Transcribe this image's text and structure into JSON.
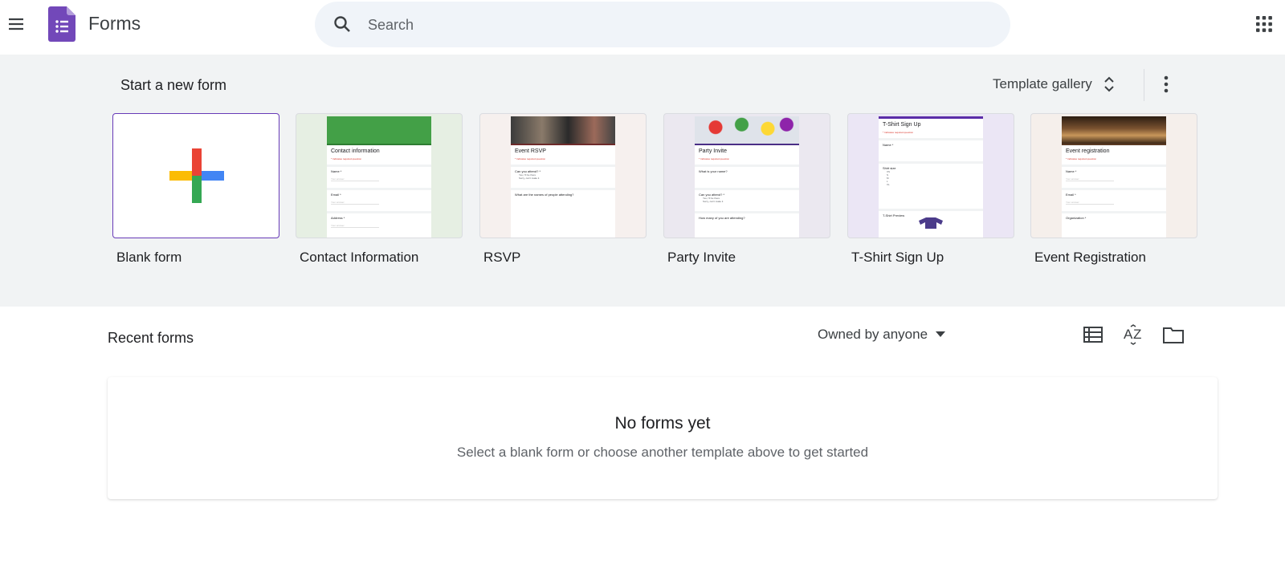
{
  "header": {
    "app_title": "Forms",
    "search": {
      "placeholder": "Search",
      "value": ""
    },
    "icons": {
      "menu": "hamburger-menu-icon",
      "logo": "google-forms-logo",
      "search": "search-icon",
      "apps": "google-apps-grid-icon"
    }
  },
  "templates": {
    "section_title": "Start a new form",
    "gallery_label": "Template gallery",
    "items": [
      {
        "label": "Blank form",
        "accent": "#673ab7",
        "bg": "#ffffff"
      },
      {
        "label": "Contact Information",
        "accent": "#43a047",
        "bg": "#e6efe3",
        "doc_title": "Contact information",
        "doc_req": "* Indicates required question",
        "q": [
          "Name *",
          "Email *",
          "Address *"
        ],
        "placeholder": "Your answer"
      },
      {
        "label": "RSVP",
        "accent": "#6d2a2a",
        "bg": "#f6f0ee",
        "doc_title": "Event RSVP",
        "doc_req": "* Indicates required question",
        "q": [
          "Can you attend? *",
          "What are the names of people attending?"
        ],
        "opts": [
          "Yes, I'll be there",
          "Sorry, can't make it"
        ]
      },
      {
        "label": "Party Invite",
        "accent": "#4a2e86",
        "bg": "#ebe8f0",
        "doc_title": "Party Invite",
        "doc_req": "* Indicates required question",
        "q": [
          "What is your name?",
          "Can you attend? *",
          "How many of you are attending?"
        ],
        "opts": [
          "Yes, I'll be there",
          "Sorry, can't make it"
        ]
      },
      {
        "label": "T-Shirt Sign Up",
        "accent": "#5b2da8",
        "bg": "#ebe6f5",
        "doc_title": "T-Shirt Sign Up",
        "doc_req": "* Indicates required question",
        "q": [
          "Name *",
          "Shirt size",
          "T-Shirt Preview"
        ],
        "opts": [
          "XS",
          "S",
          "M",
          "L",
          "XL"
        ]
      },
      {
        "label": "Event Registration",
        "accent": "#5a3a22",
        "bg": "#f5efeb",
        "doc_title": "Event registration",
        "doc_req": "* Indicates required question",
        "q": [
          "Name *",
          "Email *",
          "Organization *"
        ],
        "placeholder": "Your answer"
      }
    ]
  },
  "recent": {
    "title": "Recent forms",
    "owner_filter": "Owned by anyone",
    "view_icons": [
      "list-view-icon",
      "sort-az-icon",
      "folder-icon"
    ],
    "empty_title": "No forms yet",
    "empty_subtitle": "Select a blank form or choose another template above to get started"
  }
}
